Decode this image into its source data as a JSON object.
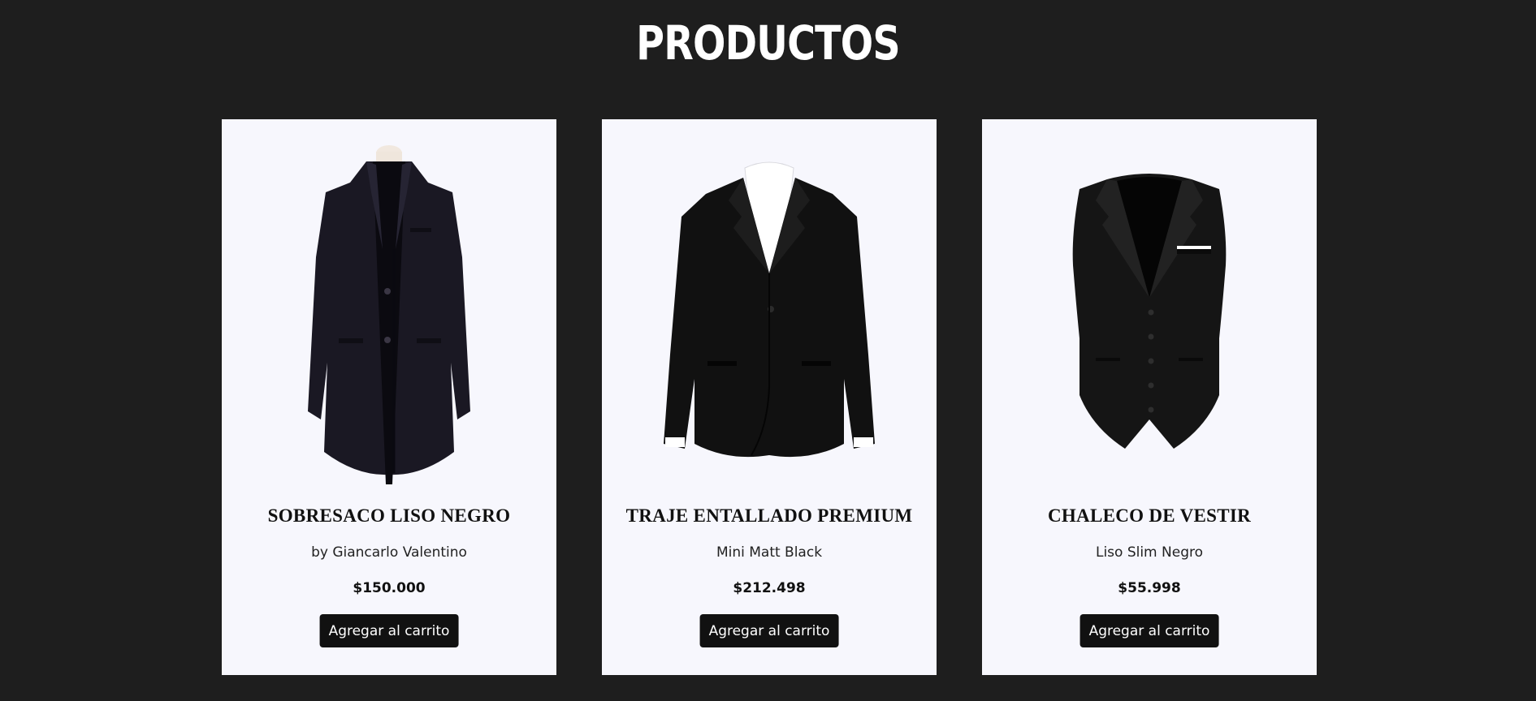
{
  "page": {
    "title": "PRODUCTOS"
  },
  "colors": {
    "background": "#1e1e1e",
    "card_background": "#f7f7fd",
    "button_background": "#111111",
    "button_text": "#ffffff"
  },
  "products": [
    {
      "image": "black-overcoat-image",
      "title": "SOBRESACO LISO NEGRO",
      "subtitle": "by Giancarlo Valentino",
      "price": "$150.000",
      "button_label": "Agregar al carrito"
    },
    {
      "image": "black-suit-jacket-image",
      "title": "TRAJE ENTALLADO PREMIUM",
      "subtitle": "Mini Matt Black",
      "price": "$212.498",
      "button_label": "Agregar al carrito"
    },
    {
      "image": "black-vest-image",
      "title": "CHALECO DE VESTIR",
      "subtitle": "Liso Slim Negro",
      "price": "$55.998",
      "button_label": "Agregar al carrito"
    }
  ]
}
